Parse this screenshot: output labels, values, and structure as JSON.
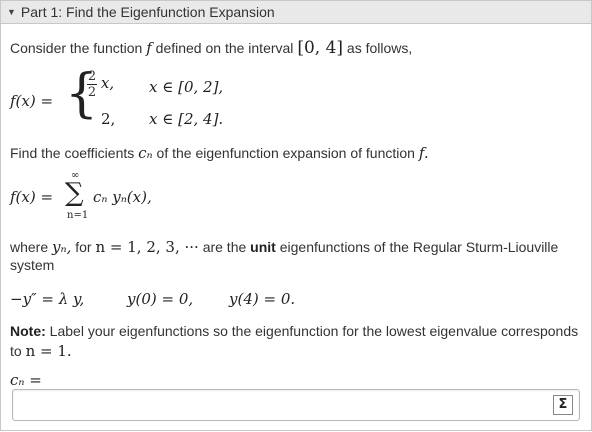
{
  "header": {
    "title": "Part 1: Find the Eigenfunction Expansion",
    "toggle_icon": "triangle-down-icon"
  },
  "intro": {
    "text_a": "Consider the function",
    "func": "f",
    "text_b": "defined on the interval",
    "interval": "[0, 4]",
    "text_c": "as follows,"
  },
  "piecewise": {
    "lhs": "f(x) =",
    "case1_num": "2",
    "case1_den": "2",
    "case1_expr": "x,",
    "case1_cond": "x ∈ [0, 2],",
    "case2_expr": "2,",
    "case2_cond": "x ∈ [2, 4]."
  },
  "find": {
    "text_a": "Find the coefficients",
    "cn": "cₙ",
    "text_b": "of the eigenfunction expansion of function",
    "func": "f."
  },
  "series": {
    "lhs": "f(x) =",
    "upper": "∞",
    "sigma": "∑",
    "lower": "n=1",
    "summand": "cₙ yₙ(x),"
  },
  "where": {
    "text_a": "where",
    "yn": "yₙ,",
    "text_b": "for",
    "nvals": "n = 1, 2, 3, ···",
    "text_c": "are the",
    "bold": "unit",
    "text_d": "eigenfunctions of the Regular Sturm-Liouville",
    "text_e": "system"
  },
  "system": {
    "eq1": "−y″ = λ y,",
    "eq2": "y(0) = 0,",
    "eq3": "y(4) = 0."
  },
  "note": {
    "label": "Note:",
    "text_a": "Label your eigenfunctions so the eigenfunction for the lowest eigenvalue corresponds",
    "text_b": "to",
    "eq": "n = 1."
  },
  "answer": {
    "label": "cₙ =",
    "value": "",
    "sigma_button": "Σ"
  }
}
